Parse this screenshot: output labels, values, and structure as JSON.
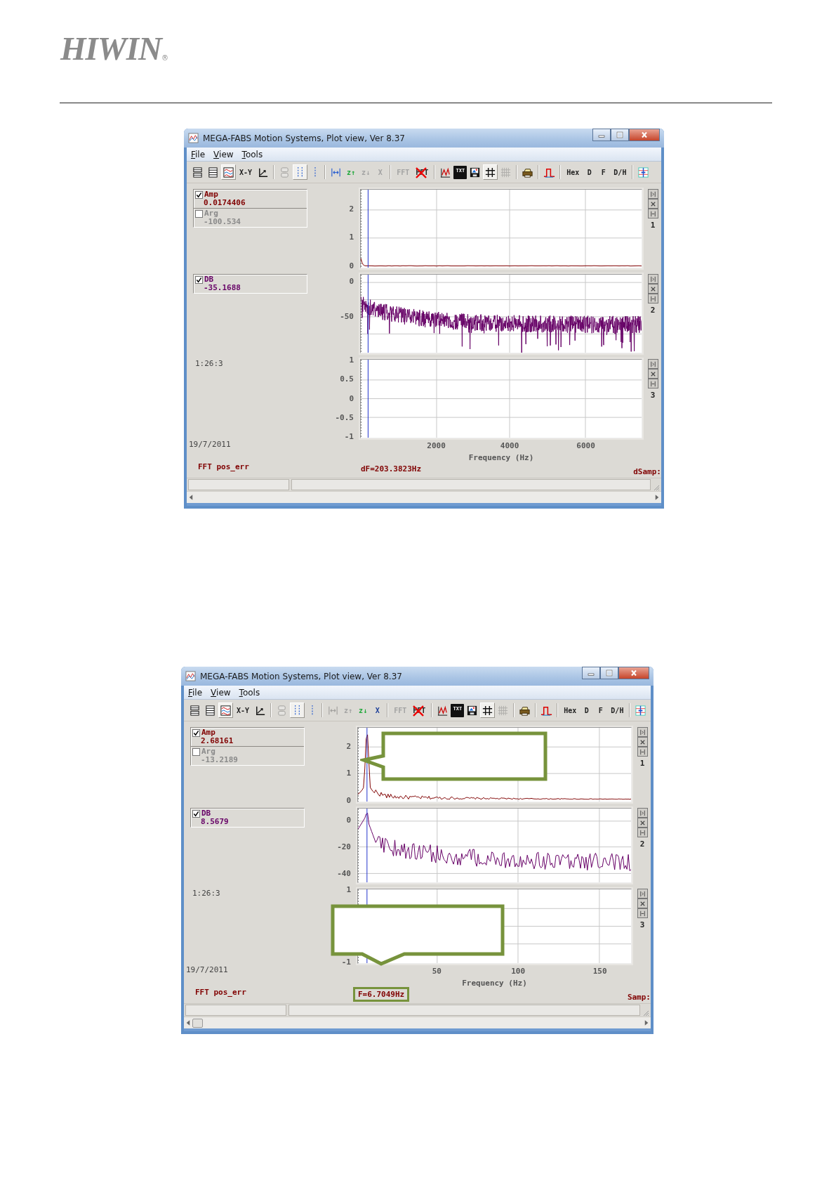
{
  "header": {
    "logo": "HIWIN",
    "mark": "®"
  },
  "windows": [
    {
      "title": "MEGA-FABS Motion Systems, Plot view, Ver 8.37",
      "menu": [
        "File",
        "View",
        "Tools"
      ],
      "toolbar": [
        {
          "kind": "icon",
          "selected": false,
          "disabled": false
        },
        {
          "kind": "icon",
          "selected": false,
          "disabled": false
        },
        {
          "kind": "icon",
          "selected": true,
          "disabled": false
        },
        {
          "kind": "text",
          "label": "X-Y",
          "selected": false,
          "disabled": false
        },
        {
          "kind": "icon",
          "selected": false,
          "disabled": false
        },
        {
          "kind": "sep"
        },
        {
          "kind": "icon",
          "selected": false,
          "disabled": true
        },
        {
          "kind": "icon",
          "selected": true,
          "disabled": false
        },
        {
          "kind": "icon",
          "selected": false,
          "disabled": false
        },
        {
          "kind": "sep"
        },
        {
          "kind": "icon",
          "selected": false,
          "disabled": false
        },
        {
          "kind": "text",
          "label": "z↑",
          "color": "#1fa83a",
          "selected": false,
          "disabled": false
        },
        {
          "kind": "text",
          "label": "z↓",
          "selected": false,
          "disabled": true
        },
        {
          "kind": "text",
          "label": "X",
          "selected": false,
          "disabled": true
        },
        {
          "kind": "sep"
        },
        {
          "kind": "text",
          "label": "FFT",
          "crossed": false,
          "selected": false,
          "disabled": true
        },
        {
          "kind": "text",
          "label": "FFT",
          "crossed": true,
          "selected": false,
          "disabled": false
        },
        {
          "kind": "sep"
        },
        {
          "kind": "icon",
          "selected": false,
          "disabled": false
        },
        {
          "kind": "floppy",
          "label": "TXT",
          "selected": false,
          "disabled": false
        },
        {
          "kind": "icon",
          "selected": false,
          "disabled": false
        },
        {
          "kind": "icon",
          "selected": true,
          "disabled": false
        },
        {
          "kind": "icon",
          "selected": false,
          "disabled": true
        },
        {
          "kind": "sep"
        },
        {
          "kind": "icon",
          "selected": false,
          "disabled": false
        },
        {
          "kind": "sep"
        },
        {
          "kind": "icon",
          "selected": false,
          "disabled": false
        },
        {
          "kind": "sep"
        },
        {
          "kind": "text",
          "label": "Hex",
          "selected": false,
          "disabled": false
        },
        {
          "kind": "text",
          "label": "D",
          "selected": false,
          "disabled": false
        },
        {
          "kind": "text",
          "label": "F",
          "selected": false,
          "disabled": false
        },
        {
          "kind": "text",
          "label": "D/H",
          "selected": false,
          "disabled": false
        },
        {
          "kind": "sep"
        },
        {
          "kind": "icon",
          "selected": false,
          "disabled": false
        }
      ],
      "plots": [
        {
          "number": "1",
          "yticks": [
            "2",
            "1",
            "0"
          ],
          "kind": "amp-flat",
          "legend": [
            {
              "label": "Amp",
              "value": "0.0174406",
              "checked": true,
              "color": "#800000"
            },
            {
              "label": "Arg",
              "value": "-100.534",
              "checked": false
            }
          ]
        },
        {
          "number": "2",
          "yticks": [
            "0",
            "-50"
          ],
          "kind": "db-dense",
          "legend": [
            {
              "label": "DB",
              "value": "-35.1688",
              "checked": true,
              "color": "#660066"
            }
          ]
        },
        {
          "number": "3",
          "yticks": [
            "1",
            "0.5",
            "0",
            "-0.5",
            "-1"
          ],
          "kind": "empty"
        }
      ],
      "time": "1:26:3",
      "date": "19/7/2011",
      "xticks": [
        "2000",
        "4000",
        "6000"
      ],
      "xlabel": "Frequency (Hz)",
      "source": "FFT pos_err",
      "readout": {
        "text": "dF=203.3823Hz",
        "highlighted": false
      },
      "samp": "dSamp:",
      "scroll_thumb": false
    },
    {
      "title": "MEGA-FABS Motion Systems, Plot view, Ver 8.37",
      "menu": [
        "File",
        "View",
        "Tools"
      ],
      "toolbar": [
        {
          "kind": "icon",
          "selected": false,
          "disabled": false
        },
        {
          "kind": "icon",
          "selected": false,
          "disabled": false
        },
        {
          "kind": "icon",
          "selected": true,
          "disabled": false
        },
        {
          "kind": "text",
          "label": "X-Y",
          "selected": false,
          "disabled": false
        },
        {
          "kind": "icon",
          "selected": false,
          "disabled": false
        },
        {
          "kind": "sep"
        },
        {
          "kind": "icon",
          "selected": false,
          "disabled": true
        },
        {
          "kind": "icon",
          "selected": true,
          "disabled": false
        },
        {
          "kind": "icon",
          "selected": false,
          "disabled": false
        },
        {
          "kind": "sep"
        },
        {
          "kind": "icon",
          "selected": false,
          "disabled": true
        },
        {
          "kind": "text",
          "label": "z↑",
          "selected": false,
          "disabled": true
        },
        {
          "kind": "text",
          "label": "z↓",
          "color": "#1fa83a",
          "selected": false,
          "disabled": false
        },
        {
          "kind": "text",
          "label": "X",
          "color": "#1d3f9a",
          "selected": false,
          "disabled": false
        },
        {
          "kind": "sep"
        },
        {
          "kind": "text",
          "label": "FFT",
          "crossed": false,
          "selected": false,
          "disabled": true
        },
        {
          "kind": "text",
          "label": "FFT",
          "crossed": true,
          "selected": false,
          "disabled": false
        },
        {
          "kind": "sep"
        },
        {
          "kind": "icon",
          "selected": false,
          "disabled": false
        },
        {
          "kind": "floppy",
          "label": "TXT",
          "selected": false,
          "disabled": false
        },
        {
          "kind": "icon",
          "selected": false,
          "disabled": false
        },
        {
          "kind": "icon",
          "selected": true,
          "disabled": false
        },
        {
          "kind": "icon",
          "selected": false,
          "disabled": true
        },
        {
          "kind": "sep"
        },
        {
          "kind": "icon",
          "selected": false,
          "disabled": false
        },
        {
          "kind": "sep"
        },
        {
          "kind": "icon",
          "selected": false,
          "disabled": false
        },
        {
          "kind": "sep"
        },
        {
          "kind": "text",
          "label": "Hex",
          "selected": false,
          "disabled": false
        },
        {
          "kind": "text",
          "label": "D",
          "selected": false,
          "disabled": false
        },
        {
          "kind": "text",
          "label": "F",
          "selected": false,
          "disabled": false
        },
        {
          "kind": "text",
          "label": "D/H",
          "selected": false,
          "disabled": false
        },
        {
          "kind": "sep"
        },
        {
          "kind": "icon",
          "selected": false,
          "disabled": false
        }
      ],
      "plots": [
        {
          "number": "1",
          "yticks": [
            "2",
            "1",
            "0"
          ],
          "kind": "amp-peak",
          "callout": {
            "kind": "left"
          },
          "legend": [
            {
              "label": "Amp",
              "value": "2.68161",
              "checked": true,
              "color": "#800000"
            },
            {
              "label": "Arg",
              "value": "-13.2189",
              "checked": false
            }
          ]
        },
        {
          "number": "2",
          "yticks": [
            "0",
            "-20",
            "-40"
          ],
          "kind": "db-line",
          "legend": [
            {
              "label": "DB",
              "value": "8.5679",
              "checked": true,
              "color": "#660066"
            }
          ]
        },
        {
          "number": "3",
          "yticks": [
            "1",
            "-1"
          ],
          "kind": "empty",
          "callout": {
            "kind": "down"
          }
        }
      ],
      "time": "1:26:3",
      "date": "19/7/2011",
      "xticks": [
        "50",
        "100",
        "150"
      ],
      "xlabel": "Frequency (Hz)",
      "source": "FFT pos_err",
      "readout": {
        "text": "F=6.7049Hz",
        "highlighted": true
      },
      "samp": "Samp:",
      "scroll_thumb": true
    }
  ]
}
